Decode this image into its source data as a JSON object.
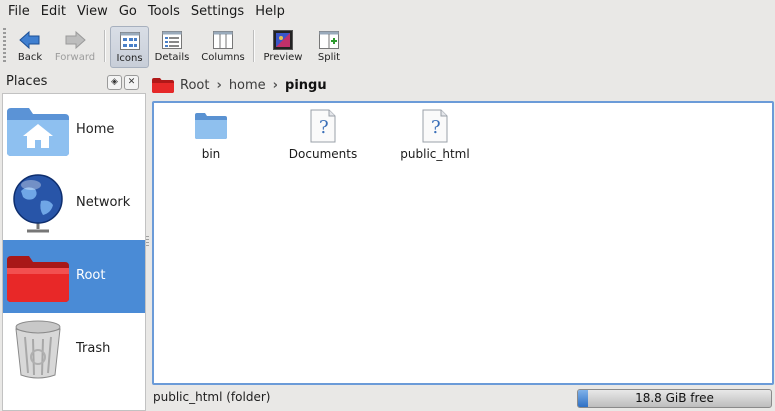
{
  "menu": [
    "File",
    "Edit",
    "View",
    "Go",
    "Tools",
    "Settings",
    "Help"
  ],
  "toolbar": {
    "back": "Back",
    "forward": "Forward",
    "icons": "Icons",
    "details": "Details",
    "columns": "Columns",
    "preview": "Preview",
    "split": "Split"
  },
  "places": {
    "title": "Places",
    "items": [
      {
        "label": "Home",
        "icon": "home-folder-icon"
      },
      {
        "label": "Network",
        "icon": "network-globe-icon"
      },
      {
        "label": "Root",
        "icon": "red-folder-icon",
        "selected": true
      },
      {
        "label": "Trash",
        "icon": "trash-bin-icon"
      }
    ]
  },
  "breadcrumb": [
    "Root",
    "home",
    "pingu"
  ],
  "files": [
    {
      "name": "bin",
      "icon": "folder-icon"
    },
    {
      "name": "Documents",
      "icon": "unknown-file-icon"
    },
    {
      "name": "public_html",
      "icon": "unknown-file-icon"
    }
  ],
  "status": {
    "text": "public_html (folder)",
    "free": "18.8 GiB free",
    "used_fraction": 0.05
  },
  "colors": {
    "selection": "#4a8bd6",
    "view_border": "#6b9bd8",
    "root_folder": "#e02020"
  }
}
